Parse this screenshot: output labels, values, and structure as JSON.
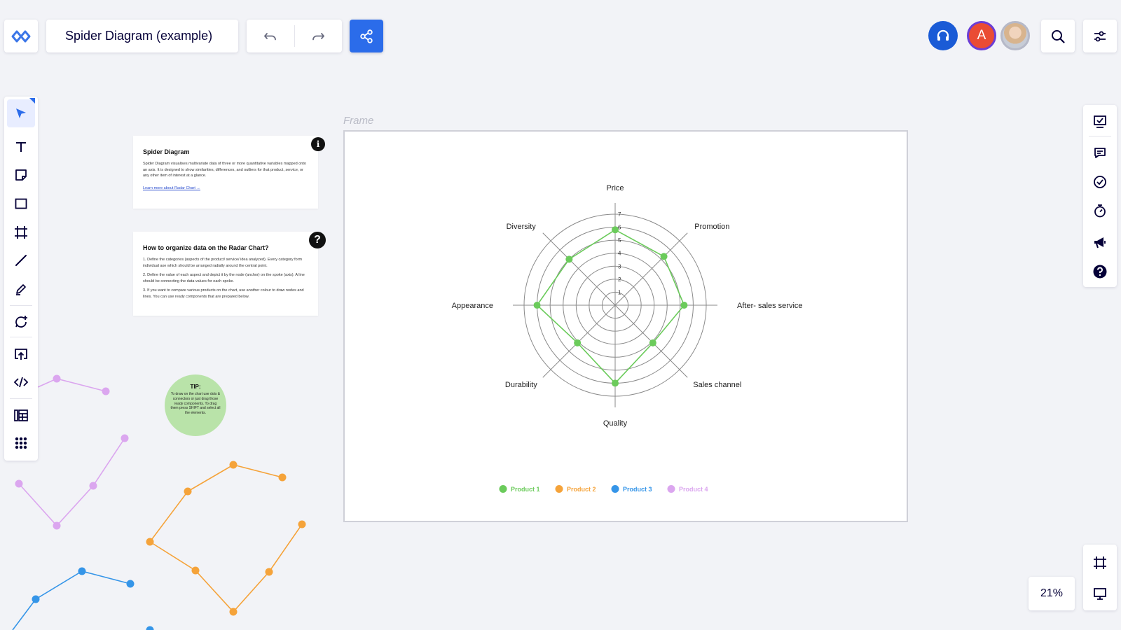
{
  "header": {
    "board_title": "Spider Diagram (example)",
    "avatar_initial": "A"
  },
  "icons": {
    "logo": "miro-logo-icon",
    "undo": "undo-icon",
    "redo": "redo-icon",
    "share": "share-icon",
    "headset": "headset-icon",
    "search": "search-icon",
    "settings": "sliders-icon"
  },
  "left_tools": [
    "select",
    "text",
    "sticky-note",
    "shape",
    "frame",
    "line",
    "pen",
    "comment-add",
    "upload",
    "embed",
    "templates",
    "apps"
  ],
  "right_tools": [
    "presentation",
    "chat",
    "check",
    "timer",
    "announce",
    "help"
  ],
  "zoom": {
    "level": "21%"
  },
  "frame": {
    "label": "Frame"
  },
  "info_cards": {
    "spider": {
      "title": "Spider Diagram",
      "body": "Spider Diagram visualises multivariate data of three or more quantitative variables mapped onto an axis. It is designed to show similarities, differences, and outliers for that product, service, or any other item of interest at a glance.",
      "link": "Learn more about Radar Chart →",
      "badge": "i"
    },
    "organize": {
      "title": "How to organize data on the Radar Chart?",
      "steps": [
        "1. Define the categories (aspects of the product/ service/ idea analyzed). Every category form individual axe which should be arranged radially around the central point.",
        "2. Define the value of each aspect and depict it by the node (anchor) on the spoke (axis). A line should be connecting the data values for each spoke.",
        "3. If you want to compare various products on the chart, use another colour to draw nodes and lines. You can use ready components that are prepared below."
      ],
      "badge": "?"
    },
    "tip": {
      "title": "TIP:",
      "text": "To draw on the chart use dots & connectors or just drag those ready components. To drag them press SHIFT and select all the elements."
    }
  },
  "chart_data": {
    "type": "radar",
    "axes": [
      "Price",
      "Promotion",
      "After- sales service",
      "Sales channel",
      "Quality",
      "Durability",
      "Appearance",
      "Diversity"
    ],
    "scale_ticks": [
      "1",
      "2",
      "3",
      "4",
      "5",
      "6",
      "7"
    ],
    "range": [
      0,
      7
    ],
    "series": [
      {
        "name": "Product 1",
        "color": "#6bcb5b",
        "values": [
          5.8,
          5.3,
          5.3,
          4.1,
          6.0,
          4.1,
          6.0,
          5.0
        ]
      }
    ],
    "legend": [
      {
        "name": "Product 1",
        "color": "#6bcb5b"
      },
      {
        "name": "Product 2",
        "color": "#f5a33a"
      },
      {
        "name": "Product 3",
        "color": "#3595e8"
      },
      {
        "name": "Product 4",
        "color": "#dba6ef"
      }
    ],
    "legend_position": "bottom"
  },
  "decorations": {
    "product2_color": "#f5a33a",
    "product3_color": "#3595e8",
    "product4_color": "#dba6ef"
  }
}
